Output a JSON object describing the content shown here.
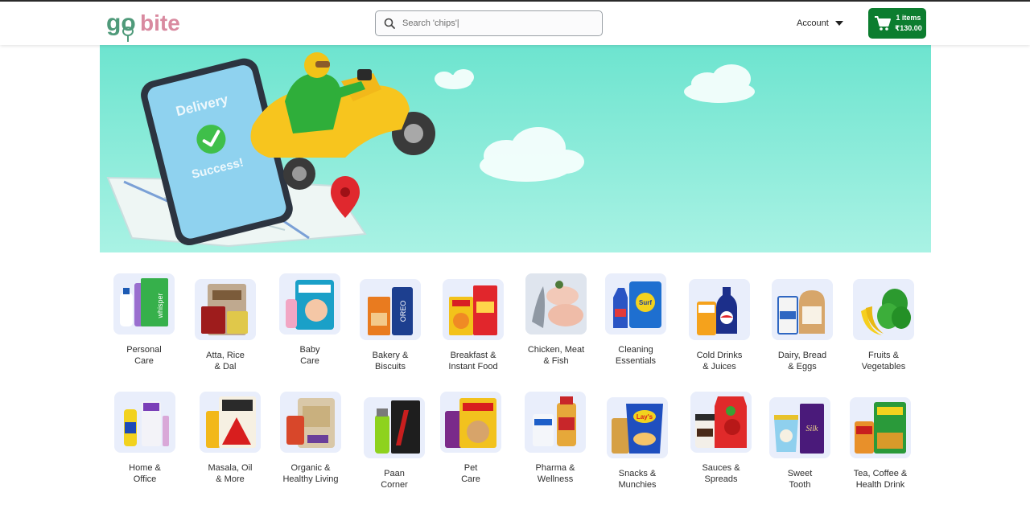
{
  "header": {
    "logo_word_go": "go",
    "logo_word_bite": "bite",
    "search_placeholder": "Search 'chips'|",
    "account_label": "Account",
    "cart_items": "1 items",
    "cart_total": "₹130.00"
  },
  "banner": {
    "phone_text_1": "Delivery",
    "phone_text_2": "Success!"
  },
  "categories_row1": [
    {
      "line1": "Personal",
      "line2": "Care",
      "icon": "personal-care-products"
    },
    {
      "line1": "Atta, Rice",
      "line2": "& Dal",
      "icon": "atta-rice-dal-bags"
    },
    {
      "line1": "Baby",
      "line2": "Care",
      "icon": "baby-diapers-pack"
    },
    {
      "line1": "Bakery &",
      "line2": "Biscuits",
      "icon": "biscuits-packs"
    },
    {
      "line1": "Breakfast &",
      "line2": "Instant Food",
      "icon": "cereal-noodles"
    },
    {
      "line1": "Chicken, Meat",
      "line2": "& Fish",
      "icon": "meat-fish"
    },
    {
      "line1": "Cleaning",
      "line2": "Essentials",
      "icon": "detergent-cleaner"
    },
    {
      "line1": "Cold Drinks",
      "line2": "& Juices",
      "icon": "soft-drink-bottles"
    },
    {
      "line1": "Dairy, Bread",
      "line2": "& Eggs",
      "icon": "milk-bread"
    },
    {
      "line1": "Fruits &",
      "line2": "Vegetables",
      "icon": "banana-spinach"
    }
  ],
  "categories_row2": [
    {
      "line1": "Home &",
      "line2": "Office",
      "icon": "home-office-supplies"
    },
    {
      "line1": "Masala, Oil",
      "line2": "& More",
      "icon": "masala-oil"
    },
    {
      "line1": "Organic &",
      "line2": "Healthy Living",
      "icon": "organic-pack"
    },
    {
      "line1": "Paan",
      "line2": "Corner",
      "icon": "lighter-paan"
    },
    {
      "line1": "Pet",
      "line2": "Care",
      "icon": "pet-food"
    },
    {
      "line1": "Pharma &",
      "line2": "Wellness",
      "icon": "pharma-bottles"
    },
    {
      "line1": "Snacks &",
      "line2": "Munchies",
      "icon": "chips-packets"
    },
    {
      "line1": "Sauces &",
      "line2": "Spreads",
      "icon": "sauce-spread-jars"
    },
    {
      "line1": "Sweet",
      "line2": "Tooth",
      "icon": "ice-cream-chocolate"
    },
    {
      "line1": "Tea, Coffee &",
      "line2": "Health Drink",
      "icon": "tea-health-drink"
    }
  ],
  "colors": {
    "brand_green": "#0c7d2f",
    "logo_green": "#4f9a7a",
    "logo_pink": "#d98aa0",
    "banner_teal": "#7debd8",
    "tile_bg": "#e9eefb"
  }
}
